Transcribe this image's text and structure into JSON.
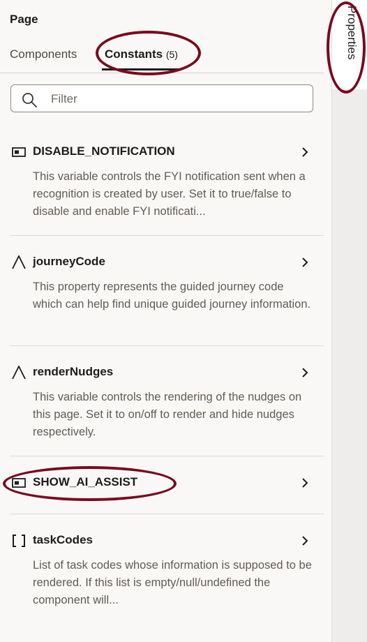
{
  "header": {
    "title": "Page"
  },
  "tabs": {
    "components_label": "Components",
    "constants_label": "Constants",
    "constants_count": "(5)"
  },
  "filter": {
    "placeholder": "Filter",
    "value": ""
  },
  "constants": [
    {
      "name": "DISABLE_NOTIFICATION",
      "type_icon": "boolean-toggle-icon",
      "description": "This variable controls the FYI notification sent when a recognition is created by user. Set it to true/false to disable and enable FYI notificati..."
    },
    {
      "name": "journeyCode",
      "type_icon": "string-type-icon",
      "description": "This property represents the guided journey code which can help find unique guided journey information."
    },
    {
      "name": "renderNudges",
      "type_icon": "string-type-icon",
      "description": "This variable controls the rendering of the nudges on this page. Set it to on/off to render and hide nudges respectively."
    },
    {
      "name": "SHOW_AI_ASSIST",
      "type_icon": "boolean-toggle-icon",
      "description": ""
    },
    {
      "name": "taskCodes",
      "type_icon": "array-type-icon",
      "description": "List of task codes whose information is supposed to be rendered. If this list is empty/null/undefined the component will..."
    }
  ],
  "right_rail": {
    "properties_label": "Properties"
  },
  "colors": {
    "annotation": "#7a0a1e",
    "panel_bg": "#f9f8f6",
    "rail_bg": "#efedeb"
  }
}
